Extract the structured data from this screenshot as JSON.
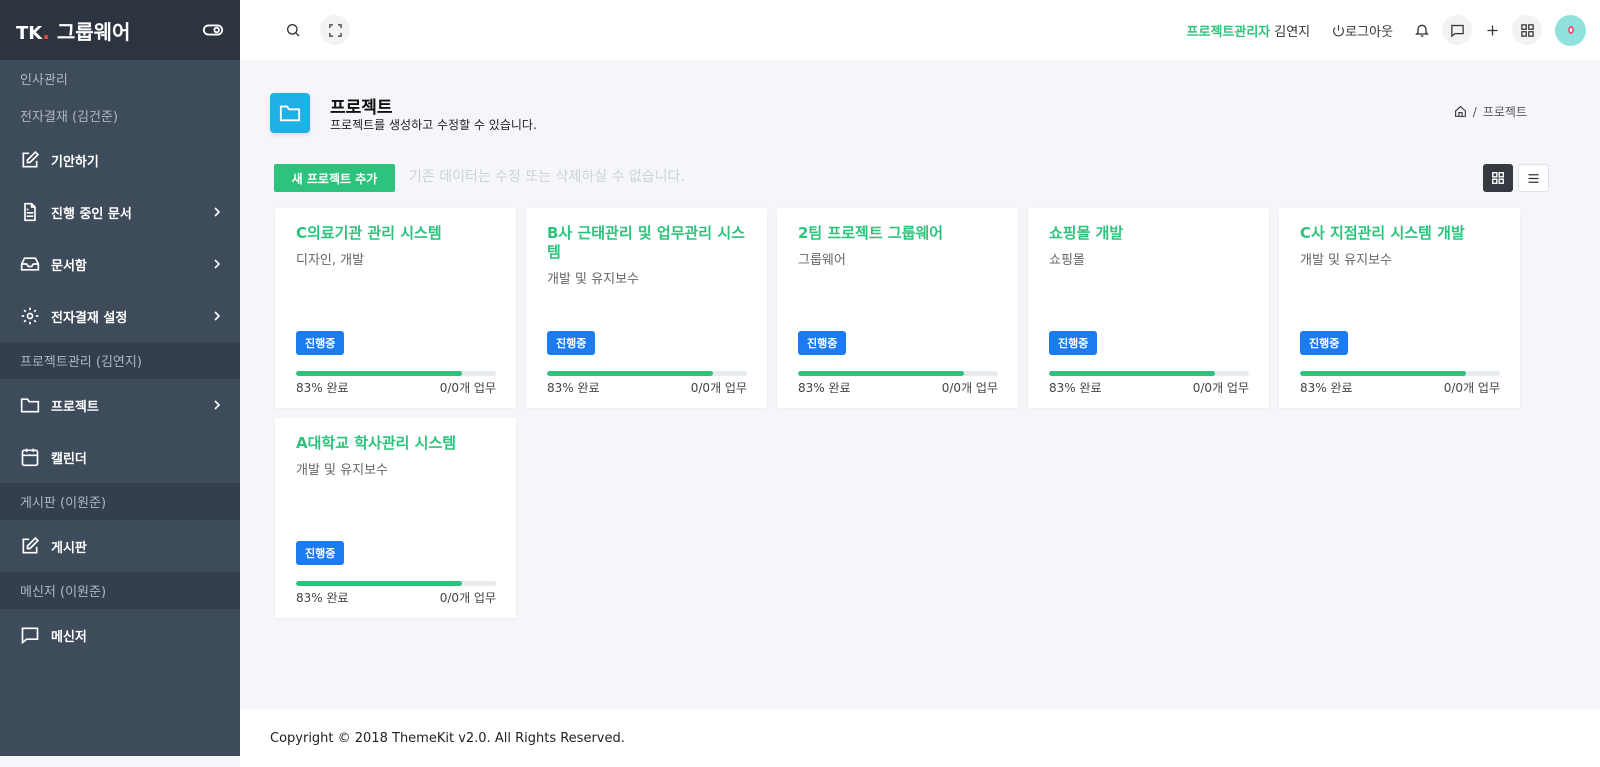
{
  "brand": {
    "prefix": "TK",
    "dot": ".",
    "name": "그룹웨어"
  },
  "sidebar": {
    "sections": [
      {
        "label": "인사관리"
      },
      {
        "label": "전자결재 (김건준)"
      },
      {
        "label": "프로젝트관리 (김연지)"
      },
      {
        "label": "게시판 (이원준)"
      },
      {
        "label": "메신저 (이원준)"
      }
    ],
    "items": [
      {
        "label": "기안하기",
        "icon": "edit-icon"
      },
      {
        "label": "진행 중인 문서",
        "icon": "document-icon"
      },
      {
        "label": "문서함",
        "icon": "inbox-icon"
      },
      {
        "label": "전자결재 설정",
        "icon": "gear-icon"
      },
      {
        "label": "프로젝트",
        "icon": "folder-icon"
      },
      {
        "label": "캘린더",
        "icon": "calendar-icon"
      },
      {
        "label": "게시판",
        "icon": "edit-icon"
      },
      {
        "label": "메신저",
        "icon": "message-icon"
      }
    ]
  },
  "topbar": {
    "role": "프로젝트관리자",
    "user": "김연지",
    "logout": "로그아웃"
  },
  "page": {
    "title": "프로젝트",
    "subtitle": "프로젝트를 생성하고 수정할 수 있습니다.",
    "breadcrumb_current": "프로젝트",
    "breadcrumb_sep": "/"
  },
  "toolbar": {
    "add_label": "새 프로젝트 추가",
    "notice": "기존 데이터는 수정 또는 삭제하실 수 없습니다."
  },
  "projects": [
    {
      "title": "C의료기관 관리 시스템",
      "category": "디자인, 개발",
      "status": "진행중",
      "progress": 83,
      "progress_text": "83% 완료",
      "tasks_text": "0/0개 업무"
    },
    {
      "title": "B사 근태관리 및 업무관리 시스템",
      "category": "개발 및 유지보수",
      "status": "진행중",
      "progress": 83,
      "progress_text": "83% 완료",
      "tasks_text": "0/0개 업무"
    },
    {
      "title": "2팀 프로젝트 그룹웨어",
      "category": "그룹웨어",
      "status": "진행중",
      "progress": 83,
      "progress_text": "83% 완료",
      "tasks_text": "0/0개 업무"
    },
    {
      "title": "쇼핑몰 개발",
      "category": "쇼핑몰",
      "status": "진행중",
      "progress": 83,
      "progress_text": "83% 완료",
      "tasks_text": "0/0개 업무"
    },
    {
      "title": "C사 지점관리 시스템 개발",
      "category": "개발 및 유지보수",
      "status": "진행중",
      "progress": 83,
      "progress_text": "83% 완료",
      "tasks_text": "0/0개 업무"
    },
    {
      "title": "A대학교 학사관리 시스템",
      "category": "개발 및 유지보수",
      "status": "진행중",
      "progress": 83,
      "progress_text": "83% 완료",
      "tasks_text": "0/0개 업무"
    }
  ],
  "footer": {
    "text": "Copyright © 2018 ThemeKit v2.0. All Rights Reserved."
  },
  "colors": {
    "accent": "#2dc37d",
    "badge": "#1a7cf0",
    "sidebar": "#3e4b5b",
    "page_icon": "#1fb0e6"
  }
}
